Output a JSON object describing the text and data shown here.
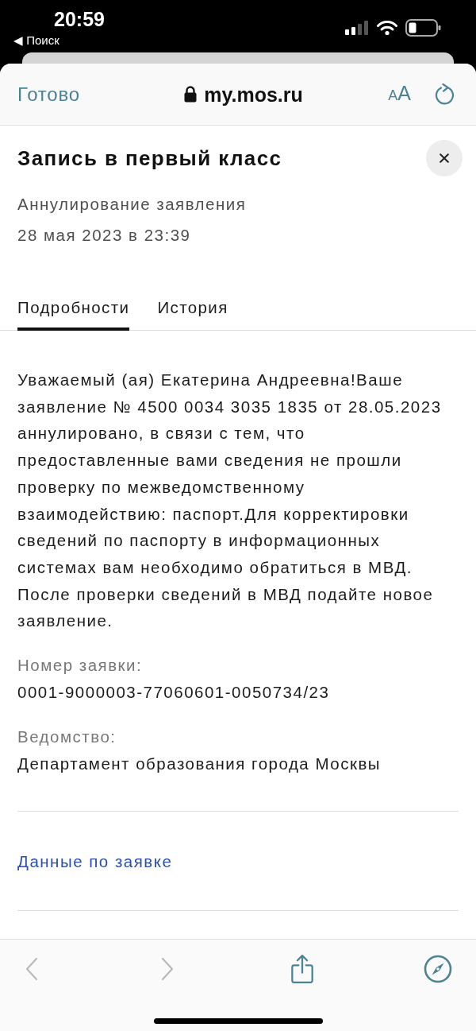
{
  "status_bar": {
    "time": "20:59",
    "back_link": "◀ Поиск"
  },
  "browser_bar": {
    "done_button": "Готово",
    "url": "my.mos.ru",
    "text_size_button": {
      "small": "A",
      "large": "A"
    }
  },
  "card": {
    "title": "Запись в первый класс",
    "status": "Аннулирование заявления",
    "date": "28 мая 2023 в 23:39"
  },
  "tabs": [
    {
      "label": "Подробности",
      "selected": true
    },
    {
      "label": "История",
      "selected": false
    }
  ],
  "message": "Уважаемый (ая) Екатерина Андреевна!Ваше заявление № 4500 0034 3035 1835 от 28.05.2023 аннулировано, в связи с тем, что предоставленные вами сведения не прошли проверку по межведомственному взаимодействию: паспорт.Для корректировки сведений по паспорту в информационных системах вам необходимо обратиться в МВД. После проверки сведений в МВД подайте новое заявление.",
  "fields": [
    {
      "label": "Номер заявки:",
      "value": "0001-9000003-77060601-0050734/23"
    },
    {
      "label": "Ведомство:",
      "value": "Департамент образования города Москвы"
    }
  ],
  "link": "Данные по заявке",
  "toolbar": [
    {
      "kind": "back",
      "disabled": true
    },
    {
      "kind": "forward",
      "disabled": true
    },
    {
      "kind": "share",
      "disabled": false
    },
    {
      "kind": "compass",
      "disabled": false
    }
  ]
}
